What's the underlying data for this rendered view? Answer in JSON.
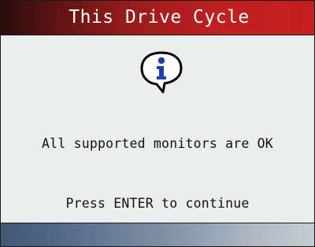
{
  "screen": {
    "title": "This Drive Cycle",
    "icon": "info-icon",
    "message": "All supported monitors are OK",
    "prompt": "Press ENTER to continue"
  },
  "colors": {
    "title_bar_dark": "#2a0c0c",
    "title_bar_accent": "#c51f1f",
    "info_icon_blue": "#1f3ea8",
    "background": "#eceeee",
    "footer_start": "#3f5875",
    "footer_end": "#c4ccd4"
  }
}
